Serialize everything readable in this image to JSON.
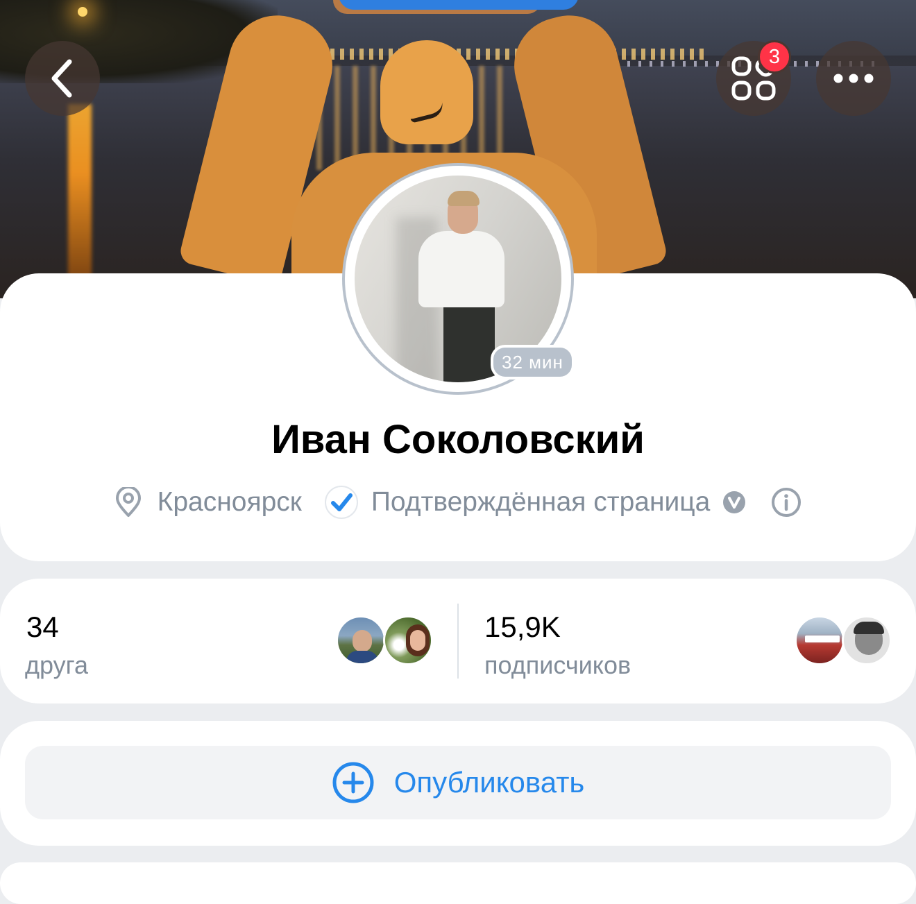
{
  "header": {
    "back_icon": "chevron-left-icon",
    "services_icon": "services-grid-icon",
    "services_badge": "3",
    "more_icon": "more-horizontal-icon"
  },
  "profile": {
    "online_status": "32 мин",
    "name": "Иван Соколовский",
    "city": "Красноярск",
    "verified_label": "Подтверждённая страница",
    "city_icon": "location-pin-icon",
    "verified_icon": "verified-check-icon",
    "verified_badge_icon": "v-badge-icon",
    "info_icon": "info-icon"
  },
  "counts": {
    "friends": {
      "value": "34",
      "label": "друга"
    },
    "followers": {
      "value": "15,9K",
      "label": "подписчиков"
    }
  },
  "actions": {
    "publish_label": "Опубликовать",
    "publish_icon": "plus-circle-icon"
  },
  "colors": {
    "accent": "#2688eb",
    "badge_red": "#ff3347",
    "secondary_text": "#818c99",
    "background": "#ebedf0"
  }
}
